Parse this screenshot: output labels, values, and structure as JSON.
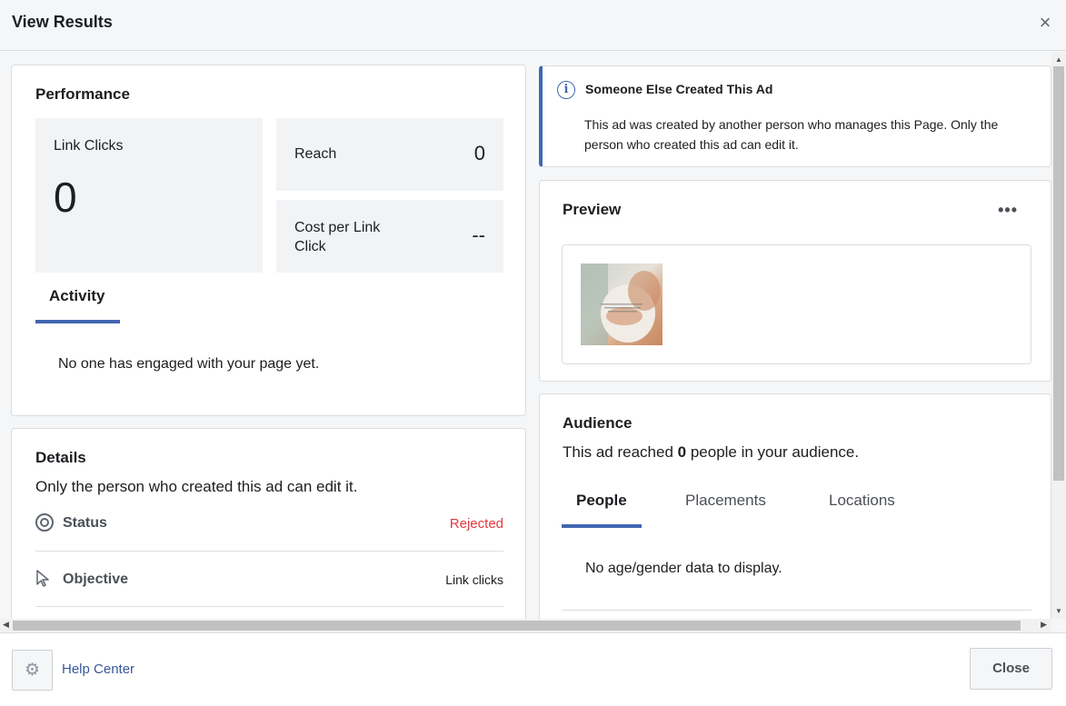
{
  "dialog": {
    "title": "View Results",
    "close_glyph": "×"
  },
  "performance": {
    "title": "Performance",
    "link_clicks": {
      "label": "Link Clicks",
      "value": "0"
    },
    "reach": {
      "label": "Reach",
      "value": "0"
    },
    "cost_per_link_click": {
      "label": "Cost per Link Click",
      "value": "--"
    },
    "activity_tab": "Activity",
    "activity_empty": "No one has engaged with your page yet."
  },
  "details": {
    "title": "Details",
    "subtitle": "Only the person who created this ad can edit it.",
    "rows": [
      {
        "label": "Status",
        "value": "Rejected",
        "icon": "status-ring-icon"
      },
      {
        "label": "Objective",
        "value": "Link clicks",
        "icon": "cursor-icon"
      }
    ],
    "status_color": "#e0393e"
  },
  "notice": {
    "icon": "info-icon",
    "title": "Someone Else Created This Ad",
    "body": "This ad was created by another person who manages this Page. Only the person who created this ad can edit it."
  },
  "preview": {
    "title": "Preview",
    "more_glyph": "•••"
  },
  "audience": {
    "title": "Audience",
    "summary_prefix": "This ad reached ",
    "summary_count": "0",
    "summary_suffix": " people in your audience.",
    "tabs": [
      "People",
      "Placements",
      "Locations"
    ],
    "empty": "No age/gender data to display."
  },
  "footer": {
    "help_label": "Help Center",
    "close_label": "Close",
    "gear_icon": "gear-icon"
  },
  "colors": {
    "accent": "#4267b2",
    "link": "#385898",
    "error": "#e0393e"
  }
}
